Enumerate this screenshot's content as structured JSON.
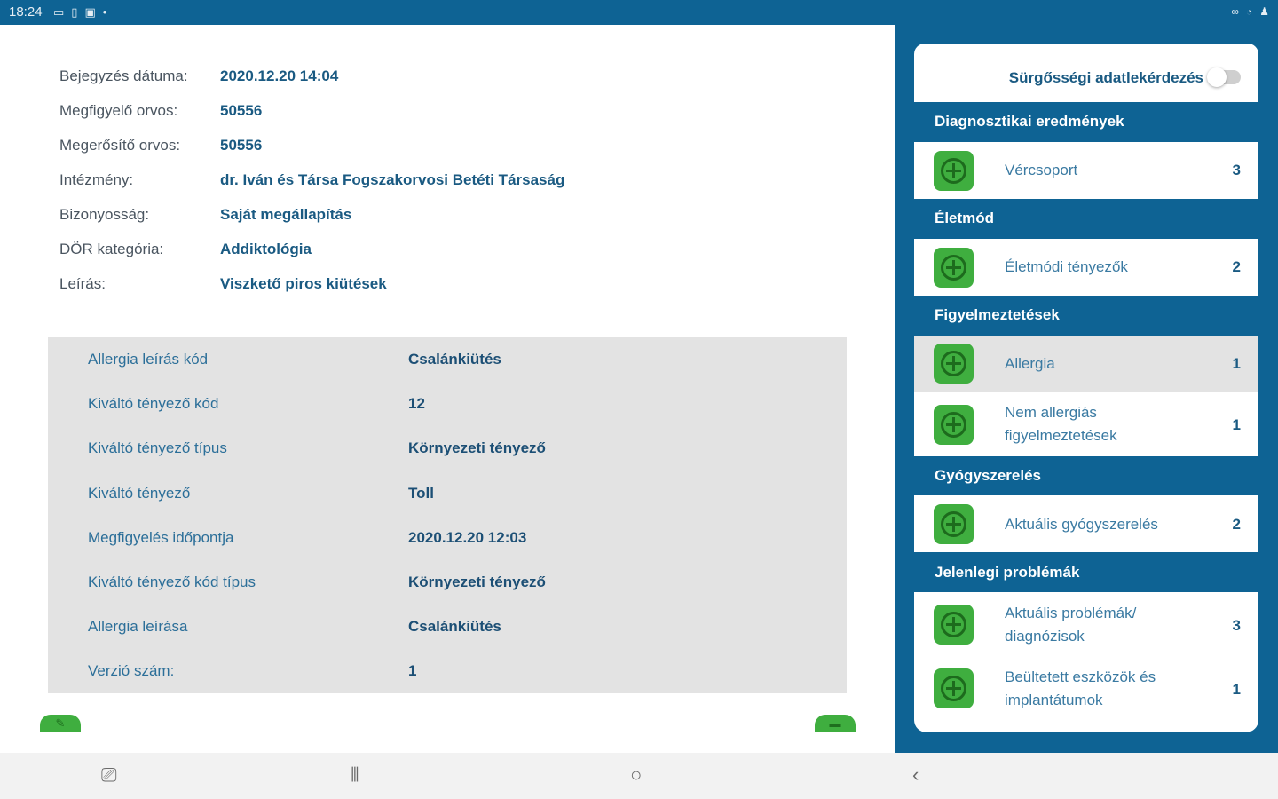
{
  "status_bar": {
    "time": "18:24",
    "left_icons": [
      "message-icon",
      "document-icon",
      "photo-icon",
      "dot-icon"
    ],
    "right_icons": [
      "link-icon",
      "wifi-icon",
      "person-icon"
    ]
  },
  "record": {
    "fields": [
      {
        "label": "Bejegyzés dátuma:",
        "value": "2020.12.20 14:04"
      },
      {
        "label": "Megfigyelő orvos:",
        "value": "50556"
      },
      {
        "label": "Megerősítő orvos:",
        "value": "50556"
      },
      {
        "label": "Intézmény:",
        "value": "dr. Iván és Társa Fogszakorvosi Betéti Társaság"
      },
      {
        "label": "Bizonyosság:",
        "value": "Saját megállapítás"
      },
      {
        "label": "DÖR kategória:",
        "value": "Addiktológia"
      },
      {
        "label": "Leírás:",
        "value": "Viszkető piros kiütések"
      }
    ]
  },
  "details": [
    {
      "label": "Allergia leírás kód",
      "value": "Csalánkiütés"
    },
    {
      "label": "Kiváltó tényező kód",
      "value": "12"
    },
    {
      "label": "Kiváltó tényező típus",
      "value": "Környezeti tényező"
    },
    {
      "label": "Kiváltó tényező",
      "value": "Toll"
    },
    {
      "label": "Megfigyelés időpontja",
      "value": "2020.12.20 12:03"
    },
    {
      "label": "Kiváltó tényező kód típus",
      "value": "Környezeti tényező"
    },
    {
      "label": "Allergia leírása",
      "value": "Csalánkiütés"
    },
    {
      "label": "Verzió szám:",
      "value": "1"
    }
  ],
  "sidebar": {
    "emergency_label": "Sürgősségi adatlekérdezés",
    "emergency_enabled": false,
    "sections": [
      {
        "title": "Diagnosztikai eredmények",
        "items": [
          {
            "label": "Vércsoport",
            "count": "3"
          }
        ]
      },
      {
        "title": "Életmód",
        "items": [
          {
            "label": "Életmódi tényezők",
            "count": "2"
          }
        ]
      },
      {
        "title": "Figyelmeztetések",
        "items": [
          {
            "label": "Allergia",
            "count": "1"
          },
          {
            "label": "Nem allergiás figyelmeztetések",
            "count": "1"
          }
        ]
      },
      {
        "title": "Gyógyszerelés",
        "items": [
          {
            "label": "Aktuális gyógyszerelés",
            "count": "2"
          }
        ]
      },
      {
        "title": "Jelenlegi problémák",
        "items": [
          {
            "label": "Aktuális problémák/ diagnózisok",
            "count": "3"
          },
          {
            "label": "Beültetett eszközök és implantátumok",
            "count": "1"
          }
        ]
      }
    ]
  },
  "navbar": {
    "buttons": [
      "screenshot-icon",
      "recents-icon",
      "home-icon",
      "back-icon"
    ]
  },
  "colors": {
    "brand_blue": "#0e6394",
    "accent_green": "#3fae3f",
    "value_text": "#1a5a82"
  }
}
